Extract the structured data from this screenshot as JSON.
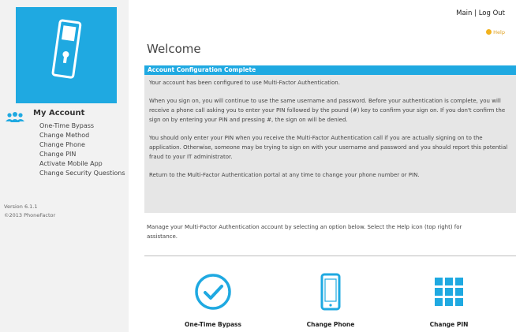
{
  "header": {
    "main_link": "Main",
    "separator": " | ",
    "logout_link": "Log Out",
    "help_label": "Help"
  },
  "sidebar": {
    "account_title": "My Account",
    "items": [
      {
        "label": "One-Time Bypass"
      },
      {
        "label": "Change Method"
      },
      {
        "label": "Change Phone"
      },
      {
        "label": "Change PIN"
      },
      {
        "label": "Activate Mobile App"
      },
      {
        "label": "Change Security Questions"
      }
    ],
    "version": "Version 6.1.1",
    "copyright": "©2013 PhoneFactor"
  },
  "main": {
    "title": "Welcome",
    "panel": {
      "header": "Account Configuration Complete",
      "paragraphs": [
        "Your account has been configured to use Multi-Factor Authentication.",
        "When you sign on, you will continue to use the same username and password. Before your authentication is complete, you will receive a phone call asking you to enter your PIN followed by the pound (#) key to confirm your sign on. If you don't confirm the sign on by entering your PIN and pressing #, the sign on will be denied.",
        "You should only enter your PIN when you receive the Multi-Factor Authentication call if you are actually signing on to the application. Otherwise, someone may be trying to sign on with your username and password and you should report this potential fraud to your IT administrator.",
        "Return to the Multi-Factor Authentication portal at any time to change your phone number or PIN."
      ]
    },
    "manage_text": "Manage your Multi-Factor Authentication account by selecting an option below. Select the Help icon (top right) for assistance.",
    "tiles": [
      {
        "label": "One-Time Bypass",
        "icon": "check-circle-icon"
      },
      {
        "label": "Change Phone",
        "icon": "phone-icon"
      },
      {
        "label": "Change PIN",
        "icon": "keypad-icon"
      }
    ]
  },
  "colors": {
    "accent": "#1fa9e1",
    "panel_bg": "#e6e6e6",
    "sidebar_bg": "#f2f2f2",
    "help_icon": "#f2b21d"
  }
}
